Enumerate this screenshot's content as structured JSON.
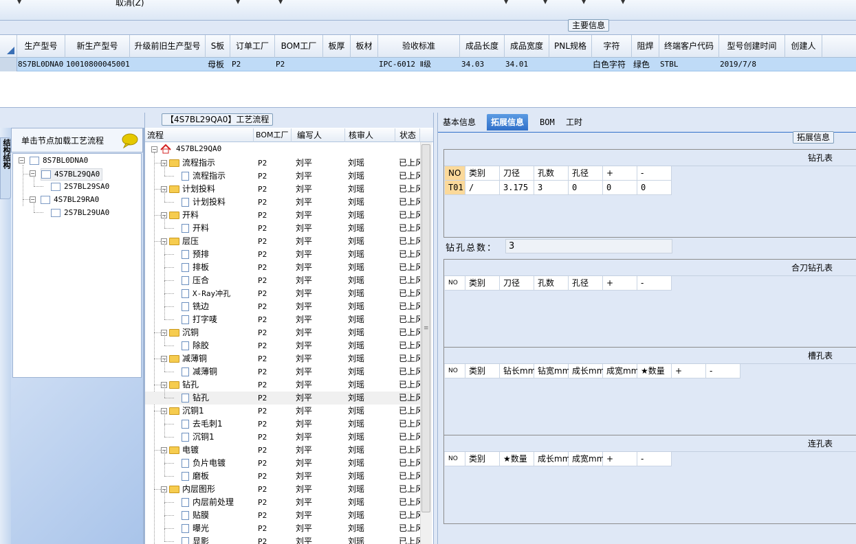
{
  "toolbar": {
    "cancel_label": "取消(Z)"
  },
  "main_info": {
    "group_title": "主要信息",
    "columns": [
      "生产型号",
      "新生产型号",
      "升级前旧生产型号",
      "S板",
      "订单工厂",
      "BOM工厂",
      "板厚",
      "板材",
      "验收标准",
      "成品长度",
      "成品宽度",
      "PNL规格",
      "字符",
      "阻焊",
      "终端客户代码",
      "型号创建时间",
      "创建人"
    ],
    "row": {
      "c0": "8S7BL0DNA0",
      "c1": "10010800045001",
      "c2": "",
      "c3": "母板",
      "c4": "P2",
      "c5": "P2",
      "c6": "",
      "c7": "",
      "c8": "IPC-6012 Ⅱ级",
      "c9": "34.03",
      "c10": "34.01",
      "c11": "",
      "c12": "白色字符",
      "c13": "绿色",
      "c14": "STBL",
      "c15": "2019/7/8",
      "c16": ""
    }
  },
  "left_panel": {
    "vertical_tab": "结构结构",
    "header": "单击节点加载工艺流程",
    "tree": [
      "8S7BL0DNA0",
      "4S7BL29QA0",
      "2S7BL29SA0",
      "4S7BL29RA0",
      "2S7BL29UA0"
    ]
  },
  "process_flow": {
    "title": "【4S7BL29QA0】工艺流程",
    "columns": [
      "流程",
      "BOM工厂",
      "编写人",
      "核审人",
      "状态"
    ],
    "root": "4S7BL29QA0",
    "rows": [
      {
        "name": "流程指示",
        "type": "folder",
        "bom": "P2",
        "writer": "刘平",
        "reviewer": "刘瑶",
        "status": "已上风"
      },
      {
        "name": "流程指示",
        "type": "doc",
        "bom": "P2",
        "writer": "刘平",
        "reviewer": "刘瑶",
        "status": "已上风"
      },
      {
        "name": "计划投料",
        "type": "folder",
        "bom": "P2",
        "writer": "刘平",
        "reviewer": "刘瑶",
        "status": "已上风"
      },
      {
        "name": "计划投料",
        "type": "doc",
        "bom": "P2",
        "writer": "刘平",
        "reviewer": "刘瑶",
        "status": "已上风"
      },
      {
        "name": "开料",
        "type": "folder",
        "bom": "P2",
        "writer": "刘平",
        "reviewer": "刘瑶",
        "status": "已上风"
      },
      {
        "name": "开料",
        "type": "doc",
        "bom": "P2",
        "writer": "刘平",
        "reviewer": "刘瑶",
        "status": "已上风"
      },
      {
        "name": "层压",
        "type": "folder",
        "bom": "P2",
        "writer": "刘平",
        "reviewer": "刘瑶",
        "status": "已上风"
      },
      {
        "name": "预排",
        "type": "doc",
        "bom": "P2",
        "writer": "刘平",
        "reviewer": "刘瑶",
        "status": "已上风"
      },
      {
        "name": "排板",
        "type": "doc",
        "bom": "P2",
        "writer": "刘平",
        "reviewer": "刘瑶",
        "status": "已上风"
      },
      {
        "name": "压合",
        "type": "doc",
        "bom": "P2",
        "writer": "刘平",
        "reviewer": "刘瑶",
        "status": "已上风"
      },
      {
        "name": "X-Ray冲孔",
        "type": "doc",
        "bom": "P2",
        "writer": "刘平",
        "reviewer": "刘瑶",
        "status": "已上风"
      },
      {
        "name": "铣边",
        "type": "doc",
        "bom": "P2",
        "writer": "刘平",
        "reviewer": "刘瑶",
        "status": "已上风"
      },
      {
        "name": "打字唛",
        "type": "doc",
        "bom": "P2",
        "writer": "刘平",
        "reviewer": "刘瑶",
        "status": "已上风"
      },
      {
        "name": "沉铜",
        "type": "folder",
        "bom": "P2",
        "writer": "刘平",
        "reviewer": "刘瑶",
        "status": "已上风"
      },
      {
        "name": "除胶",
        "type": "doc",
        "bom": "P2",
        "writer": "刘平",
        "reviewer": "刘瑶",
        "status": "已上风"
      },
      {
        "name": "减薄铜",
        "type": "folder",
        "bom": "P2",
        "writer": "刘平",
        "reviewer": "刘瑶",
        "status": "已上风"
      },
      {
        "name": "减薄铜",
        "type": "doc",
        "bom": "P2",
        "writer": "刘平",
        "reviewer": "刘瑶",
        "status": "已上风"
      },
      {
        "name": "钻孔",
        "type": "folder",
        "bom": "P2",
        "writer": "刘平",
        "reviewer": "刘瑶",
        "status": "已上风"
      },
      {
        "name": "钻孔",
        "type": "doc",
        "bom": "P2",
        "writer": "刘平",
        "reviewer": "刘瑶",
        "status": "已上风"
      },
      {
        "name": "沉铜1",
        "type": "folder",
        "bom": "P2",
        "writer": "刘平",
        "reviewer": "刘瑶",
        "status": "已上风"
      },
      {
        "name": "去毛刺1",
        "type": "doc",
        "bom": "P2",
        "writer": "刘平",
        "reviewer": "刘瑶",
        "status": "已上风"
      },
      {
        "name": "沉铜1",
        "type": "doc",
        "bom": "P2",
        "writer": "刘平",
        "reviewer": "刘瑶",
        "status": "已上风"
      },
      {
        "name": "电镀",
        "type": "folder",
        "bom": "P2",
        "writer": "刘平",
        "reviewer": "刘瑶",
        "status": "已上风"
      },
      {
        "name": "负片电镀",
        "type": "doc",
        "bom": "P2",
        "writer": "刘平",
        "reviewer": "刘瑶",
        "status": "已上风"
      },
      {
        "name": "磨板",
        "type": "doc",
        "bom": "P2",
        "writer": "刘平",
        "reviewer": "刘瑶",
        "status": "已上风"
      },
      {
        "name": "内层图形",
        "type": "folder",
        "bom": "P2",
        "writer": "刘平",
        "reviewer": "刘瑶",
        "status": "已上风"
      },
      {
        "name": "内层前处理",
        "type": "doc",
        "bom": "P2",
        "writer": "刘平",
        "reviewer": "刘瑶",
        "status": "已上风"
      },
      {
        "name": "贴膜",
        "type": "doc",
        "bom": "P2",
        "writer": "刘平",
        "reviewer": "刘瑶",
        "status": "已上风"
      },
      {
        "name": "曝光",
        "type": "doc",
        "bom": "P2",
        "writer": "刘平",
        "reviewer": "刘瑶",
        "status": "已上风"
      },
      {
        "name": "显影",
        "type": "doc",
        "bom": "P2",
        "writer": "刘平",
        "reviewer": "刘瑶",
        "status": "已上风"
      }
    ]
  },
  "right_panel": {
    "tabs": [
      "基本信息",
      "拓展信息",
      "BOM",
      "工时"
    ],
    "active_tab": "拓展信息",
    "group_title": "拓展信息",
    "drill_table": {
      "title": "钻孔表",
      "columns": [
        "NO",
        "类别",
        "刀径",
        "孔数",
        "孔径",
        "+",
        "-"
      ],
      "rows": [
        [
          "T01",
          "/",
          "3.175",
          "3",
          "0",
          "0",
          "0"
        ]
      ]
    },
    "drill_total_label": "钻孔总数：",
    "drill_total_value": "3",
    "combo_table": {
      "title": "合刀钻孔表",
      "columns": [
        "NO",
        "类别",
        "刀径",
        "孔数",
        "孔径",
        "+",
        "-"
      ]
    },
    "slot_table": {
      "title": "槽孔表",
      "columns": [
        "NO",
        "类别",
        "钻长mm",
        "钻宽mm",
        "成长mm",
        "成宽mm",
        "★数量",
        "+",
        "-"
      ]
    },
    "link_table": {
      "title": "连孔表",
      "columns": [
        "NO",
        "类别",
        "★数量",
        "成长mm",
        "成宽mm",
        "+",
        "-"
      ]
    }
  }
}
